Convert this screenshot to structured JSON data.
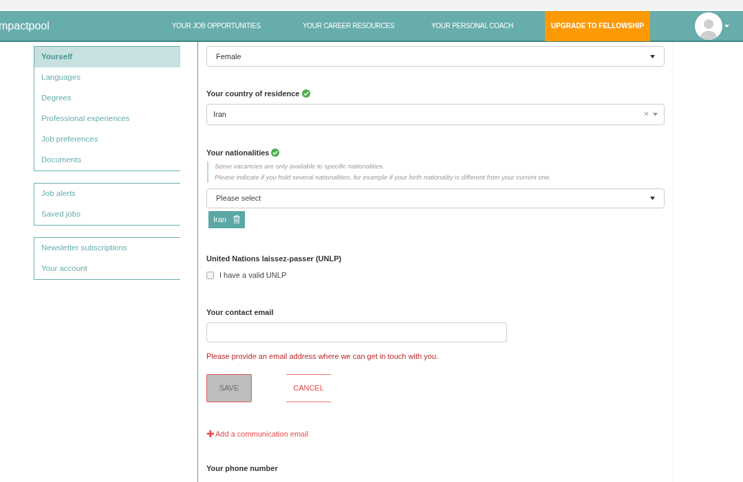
{
  "header": {
    "logo": "mpactpool",
    "nav": [
      "YOUR JOB OPPORTUNITIES",
      "YOUR CAREER RESOURCES",
      "YOUR PERSONAL COACH"
    ],
    "upgrade": "UPGRADE TO FELLOWSHIP"
  },
  "sidebar": {
    "groups": [
      {
        "items": [
          {
            "label": "Yourself",
            "selected": true
          },
          {
            "label": "Languages",
            "selected": false
          },
          {
            "label": "Degrees",
            "selected": false
          },
          {
            "label": "Professional experiences",
            "selected": false
          },
          {
            "label": "Job preferences",
            "selected": false
          },
          {
            "label": "Documents",
            "selected": false
          }
        ]
      },
      {
        "items": [
          {
            "label": "Job alerts",
            "selected": false
          },
          {
            "label": "Saved jobs",
            "selected": false
          }
        ]
      },
      {
        "items": [
          {
            "label": "Newsletter subscriptions",
            "selected": false
          },
          {
            "label": "Your account",
            "selected": false
          }
        ]
      }
    ]
  },
  "gender": {
    "value": "Female"
  },
  "residence": {
    "label": "Your country of residence",
    "verified": true,
    "value": "Iran",
    "clear": "×"
  },
  "nationalities": {
    "label": "Your nationalities",
    "verified": true,
    "hint": [
      "Some vacancies are only available to specific nationalities.",
      "Please indicate if you hold several nationalities, for example if your birth nationality is different from your current one."
    ],
    "placeholder": "Please select",
    "tags": [
      "Iran"
    ]
  },
  "unlp": {
    "label": "United Nations laissez-passer (UNLP)",
    "checkbox": {
      "label": "I have a valid UNLP",
      "checked": false
    }
  },
  "contact_email": {
    "label": "Your contact email",
    "error": "Please provide an email address where we can get in touch with you."
  },
  "buttons": {
    "save": "SAVE",
    "cancel": "CANCEL"
  },
  "add_link": {
    "icon": "✚",
    "label": "Add a communication email"
  },
  "phone": {
    "label": "Your phone number"
  }
}
